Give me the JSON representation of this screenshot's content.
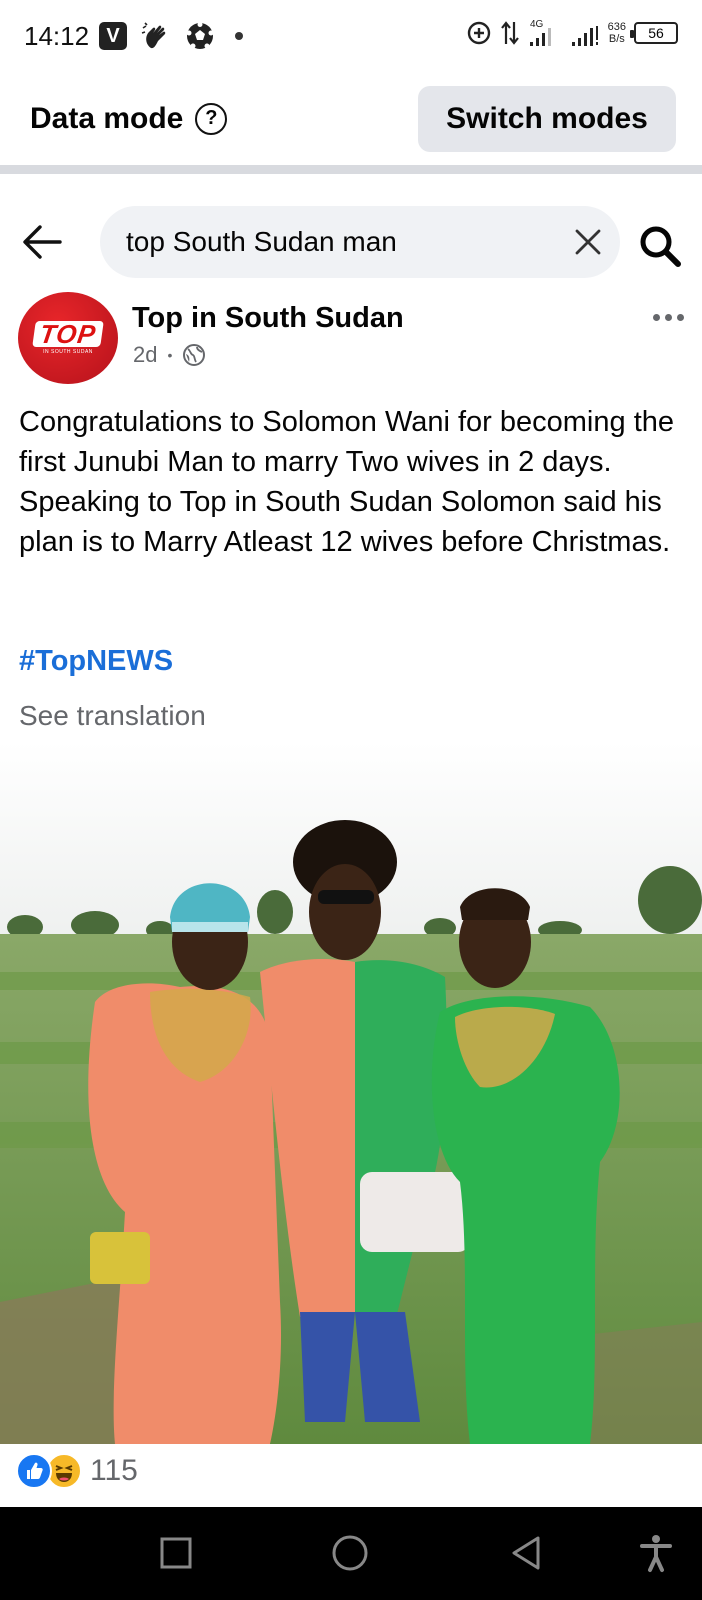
{
  "status_bar": {
    "time": "14:12",
    "left_icons": [
      "v-app-icon",
      "hand-wave-icon",
      "soccer-ball-icon",
      "notification-dot-icon"
    ],
    "network": "4G",
    "speed_value": "636",
    "speed_unit": "B/s",
    "battery": "56"
  },
  "data_mode": {
    "label": "Data mode",
    "help_icon": "help-circle-icon",
    "switch_label": "Switch modes"
  },
  "search": {
    "query": "top South Sudan man",
    "back_icon": "back-arrow-icon",
    "clear_icon": "close-icon",
    "search_icon": "search-icon"
  },
  "post": {
    "page_name": "Top in South Sudan",
    "avatar_text": "TOP",
    "avatar_subtext": "IN SOUTH SUDAN",
    "time": "2d",
    "privacy_icon": "globe-icon",
    "more_icon": "more-options-icon",
    "text": "Congratulations to Solomon Wani for becoming the first Junubi Man to marry Two wives in 2 days. Speaking to Top in South Sudan Solomon said his plan is to Marry Atleast 12 wives before Christmas.",
    "hashtag": "#TopNEWS",
    "see_translation": "See translation",
    "reaction_icons": [
      "like-icon",
      "haha-icon"
    ],
    "reaction_count": "115"
  },
  "colors": {
    "facebook_blue": "#1877f2",
    "hashtag_blue": "#1a6ed8",
    "secondary_text": "#65676b",
    "button_gray": "#e4e6eb",
    "search_bg": "#f0f2f5"
  },
  "nav_bar": {
    "buttons": [
      "recent-apps-icon",
      "home-icon",
      "back-icon",
      "accessibility-icon"
    ]
  }
}
